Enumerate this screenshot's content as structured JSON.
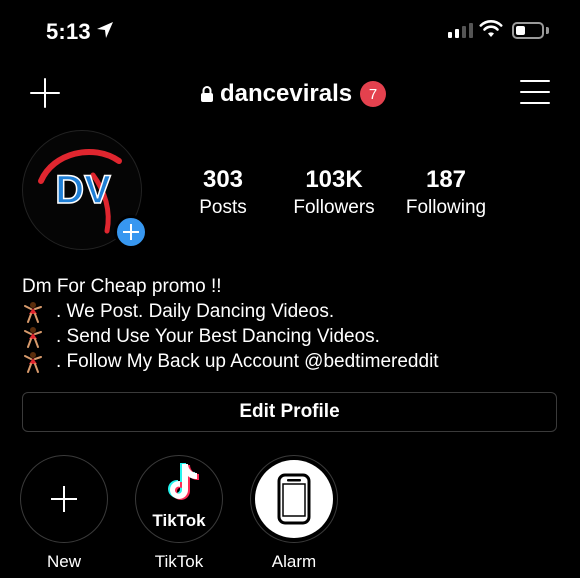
{
  "status_bar": {
    "time": "5:13",
    "icons": [
      "location-arrow-icon",
      "signal-icon",
      "wifi-icon",
      "battery-icon"
    ]
  },
  "header": {
    "username": "dancevirals",
    "notification_count": "7",
    "icons": [
      "plus-icon",
      "lock-icon",
      "menu-icon"
    ]
  },
  "profile": {
    "avatar_text": "DV",
    "stats": [
      {
        "value": "303",
        "label": "Posts"
      },
      {
        "value": "103K",
        "label": "Followers"
      },
      {
        "value": "187",
        "label": "Following"
      }
    ]
  },
  "bio": {
    "line1": "Dm For Cheap promo !!",
    "line2": ". We Post. Daily Dancing Videos.",
    "line3": ". Send Use Your Best Dancing Videos.",
    "line4": ". Follow My Back up Account @bedtimereddit"
  },
  "edit_profile_label": "Edit Profile",
  "highlights": [
    {
      "label": "New"
    },
    {
      "label": "TikTok",
      "logo_text": "TikTok"
    },
    {
      "label": "Alarm"
    }
  ],
  "colors": {
    "background": "#000000",
    "badge": "#e4414e",
    "add_story": "#3797f0",
    "avatar_red": "#e0262f",
    "avatar_blue": "#1f7fd6"
  }
}
